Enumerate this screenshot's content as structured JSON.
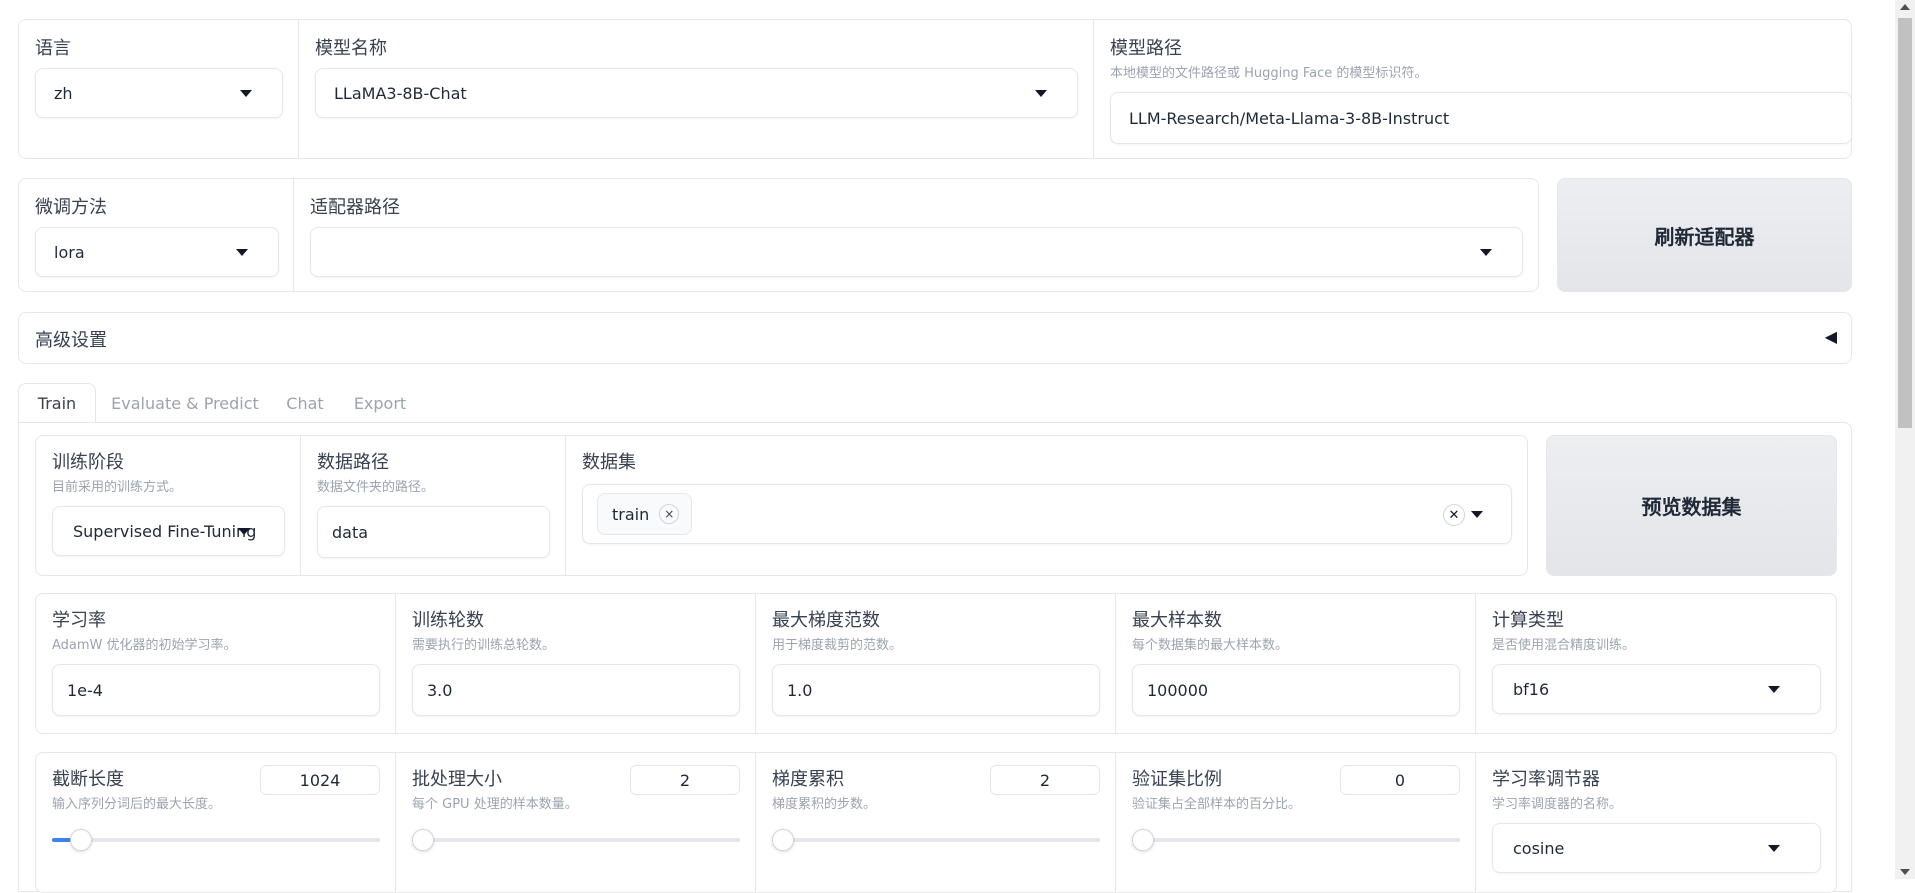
{
  "model_row": {
    "lang_label": "语言",
    "lang_value": "zh",
    "model_name_label": "模型名称",
    "model_name_value": "LLaMA3-8B-Chat",
    "model_path_label": "模型路径",
    "model_path_info": "本地模型的文件路径或 Hugging Face 的模型标识符。",
    "model_path_value": "LLM-Research/Meta-Llama-3-8B-Instruct"
  },
  "adapter_row": {
    "finetune_label": "微调方法",
    "finetune_value": "lora",
    "adapter_path_label": "适配器路径",
    "adapter_path_value": "",
    "refresh_button": "刷新适配器"
  },
  "advanced": {
    "label": "高级设置",
    "toggle_glyph": "◀"
  },
  "tabs": [
    "Train",
    "Evaluate & Predict",
    "Chat",
    "Export"
  ],
  "train": {
    "stage_label": "训练阶段",
    "stage_info": "目前采用的训练方式。",
    "stage_value": "Supervised Fine-Tuning",
    "data_dir_label": "数据路径",
    "data_dir_info": "数据文件夹的路径。",
    "data_dir_value": "data",
    "dataset_label": "数据集",
    "dataset_tag": "train",
    "dataset_tag_remove": "×",
    "dataset_clear": "✕",
    "preview_button": "预览数据集",
    "lr_label": "学习率",
    "lr_info": "AdamW 优化器的初始学习率。",
    "lr_value": "1e-4",
    "epochs_label": "训练轮数",
    "epochs_info": "需要执行的训练总轮数。",
    "epochs_value": "3.0",
    "grad_norm_label": "最大梯度范数",
    "grad_norm_info": "用于梯度裁剪的范数。",
    "grad_norm_value": "1.0",
    "max_samples_label": "最大样本数",
    "max_samples_info": "每个数据集的最大样本数。",
    "max_samples_value": "100000",
    "compute_type_label": "计算类型",
    "compute_type_info": "是否使用混合精度训练。",
    "compute_type_value": "bf16",
    "cutoff_label": "截断长度",
    "cutoff_info": "输入序列分词后的最大长度。",
    "cutoff_value": "1024",
    "cutoff_fraction": 0.06,
    "batch_label": "批处理大小",
    "batch_info": "每个 GPU 处理的样本数量。",
    "batch_value": "2",
    "batch_fraction": 0.0,
    "grad_accum_label": "梯度累积",
    "grad_accum_info": "梯度累积的步数。",
    "grad_accum_value": "2",
    "grad_accum_fraction": 0.0,
    "val_size_label": "验证集比例",
    "val_size_info": "验证集占全部样本的百分比。",
    "val_size_value": "0",
    "val_size_fraction": 0.0,
    "scheduler_label": "学习率调节器",
    "scheduler_info": "学习率调度器的名称。",
    "scheduler_value": "cosine"
  }
}
